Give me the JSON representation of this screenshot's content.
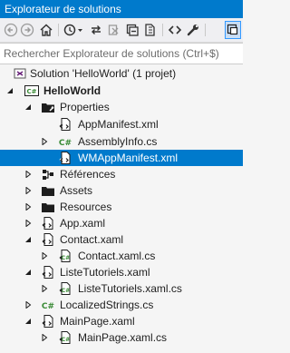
{
  "window": {
    "title": "Explorateur de solutions"
  },
  "toolbar": {
    "buttons": [
      {
        "icon": "back-arrow-icon"
      },
      {
        "icon": "forward-arrow-icon"
      },
      {
        "icon": "home-icon"
      },
      {
        "icon": "history-dropdown-icon"
      },
      {
        "icon": "sync-icon"
      },
      {
        "icon": "pending-changes-icon"
      },
      {
        "icon": "collapse-all-icon"
      },
      {
        "icon": "show-all-files-icon"
      },
      {
        "icon": "view-code-icon"
      },
      {
        "icon": "properties-wrench-icon"
      },
      {
        "icon": "preview-selected-icon"
      }
    ]
  },
  "search": {
    "placeholder": "Rechercher Explorateur de solutions (Ctrl+$)"
  },
  "tree": {
    "items": [
      {
        "label": "Solution 'HelloWorld' (1 projet)",
        "icon": "solution-icon",
        "expanded": "none"
      },
      {
        "label": "HelloWorld",
        "icon": "csharp-project-icon",
        "expanded": "open"
      },
      {
        "label": "Properties",
        "icon": "properties-folder-icon",
        "expanded": "open"
      },
      {
        "label": "AppManifest.xml",
        "icon": "xml-file-icon",
        "expanded": "none"
      },
      {
        "label": "AssemblyInfo.cs",
        "icon": "csharp-file-icon",
        "expanded": "closed"
      },
      {
        "label": "WMAppManifest.xml",
        "icon": "xml-file-icon",
        "expanded": "none",
        "selected": true
      },
      {
        "label": "Références",
        "icon": "references-icon",
        "expanded": "closed"
      },
      {
        "label": "Assets",
        "icon": "folder-icon",
        "expanded": "closed"
      },
      {
        "label": "Resources",
        "icon": "folder-icon",
        "expanded": "closed"
      },
      {
        "label": "App.xaml",
        "icon": "xaml-file-icon",
        "expanded": "closed"
      },
      {
        "label": "Contact.xaml",
        "icon": "xaml-file-icon",
        "expanded": "open"
      },
      {
        "label": "Contact.xaml.cs",
        "icon": "csharp-file-icon",
        "expanded": "closed"
      },
      {
        "label": "ListeTutoriels.xaml",
        "icon": "xaml-file-icon",
        "expanded": "open"
      },
      {
        "label": "ListeTutoriels.xaml.cs",
        "icon": "csharp-file-icon",
        "expanded": "closed"
      },
      {
        "label": "LocalizedStrings.cs",
        "icon": "csharp-file-icon",
        "expanded": "closed"
      },
      {
        "label": "MainPage.xaml",
        "icon": "xaml-file-icon",
        "expanded": "open"
      },
      {
        "label": "MainPage.xaml.cs",
        "icon": "csharp-file-icon",
        "expanded": "closed"
      }
    ]
  },
  "colors": {
    "accent": "#007acc",
    "selection": "#007acc",
    "background": "#f5f5f5"
  }
}
